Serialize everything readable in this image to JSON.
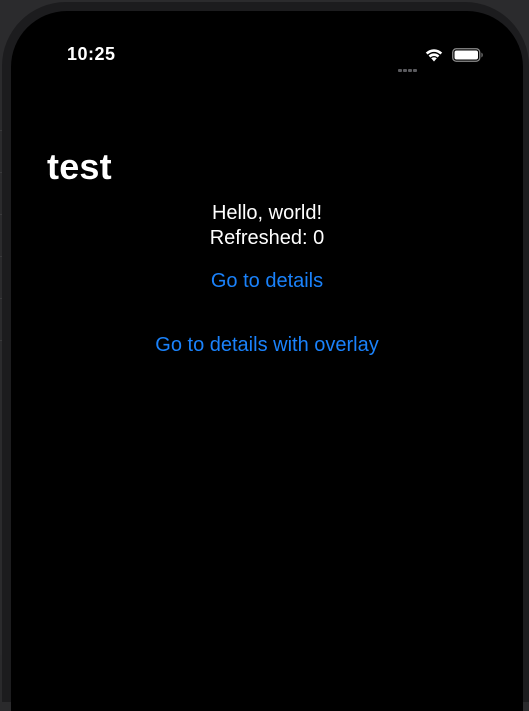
{
  "status_bar": {
    "time": "10:25"
  },
  "icons": {
    "signal": "cellular-signal-icon",
    "wifi": "wifi-icon",
    "battery": "battery-icon"
  },
  "navigation": {
    "title": "test"
  },
  "content": {
    "greeting": "Hello, world!",
    "refreshed": "Refreshed: 0"
  },
  "buttons": {
    "details_label": "Go to details",
    "overlay_label": "Go to details with overlay"
  },
  "colors": {
    "background": "#000000",
    "text": "#ffffff",
    "link": "#1a82fb"
  }
}
